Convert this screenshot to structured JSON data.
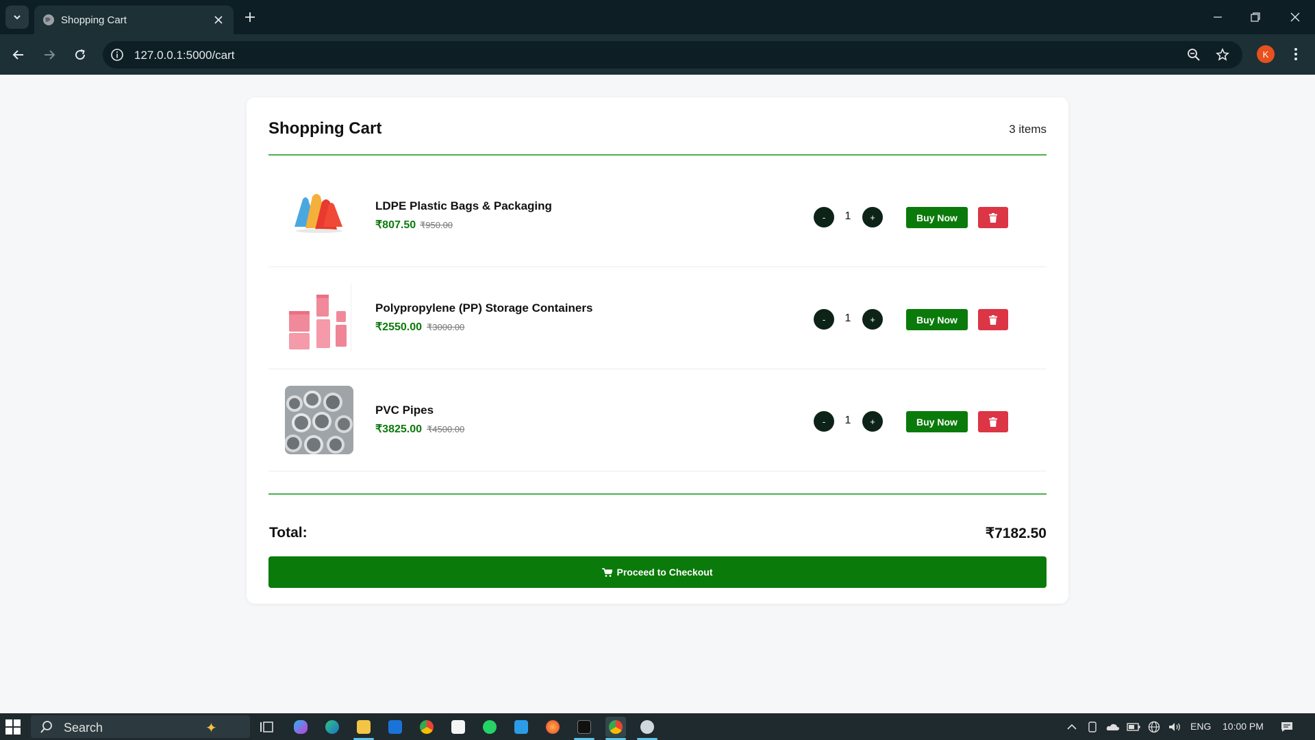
{
  "browser": {
    "tab_title": "Shopping Cart",
    "url": "127.0.0.1:5000/cart",
    "profile_initial": "K"
  },
  "cart": {
    "title": "Shopping Cart",
    "item_count": "3 items",
    "items": [
      {
        "name": "LDPE Plastic Bags & Packaging",
        "price": "₹807.50",
        "old_price": "₹950.00",
        "qty": "1",
        "minus": "-",
        "plus": "+",
        "buy_label": "Buy Now",
        "image": "plastic-bags-image"
      },
      {
        "name": "Polypropylene (PP) Storage Containers",
        "price": "₹2550.00",
        "old_price": "₹3000.00",
        "qty": "1",
        "minus": "-",
        "plus": "+",
        "buy_label": "Buy Now",
        "image": "storage-containers-image"
      },
      {
        "name": "PVC Pipes",
        "price": "₹3825.00",
        "old_price": "₹4500.00",
        "qty": "1",
        "minus": "-",
        "plus": "+",
        "buy_label": "Buy Now",
        "image": "pvc-pipes-image"
      }
    ],
    "total_label": "Total:",
    "total_value": "₹7182.50",
    "checkout_label": "Proceed to Checkout"
  },
  "taskbar": {
    "search_placeholder": "Search",
    "language": "ENG",
    "time": "10:00 PM"
  },
  "colors": {
    "accent_green": "#0a7a0a",
    "divider_green": "#4caf50",
    "delete_red": "#dc3545",
    "qty_button": "#0d2318"
  }
}
